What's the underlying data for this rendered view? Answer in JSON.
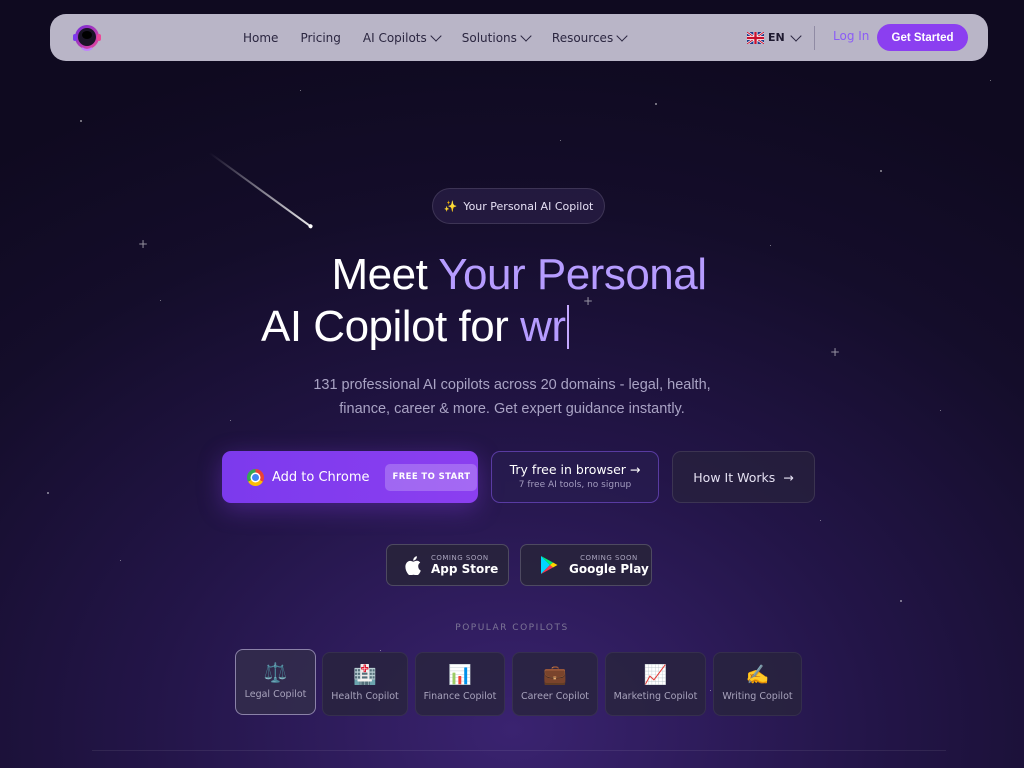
{
  "nav": {
    "links": [
      {
        "label": "Home"
      },
      {
        "label": "Pricing"
      },
      {
        "label": "AI Copilots"
      },
      {
        "label": "Solutions"
      },
      {
        "label": "Resources"
      }
    ],
    "language": "EN",
    "login": "Log In",
    "get_started": "Get Started"
  },
  "hero": {
    "badge_icon": "✨",
    "badge": "Your Personal AI Copilot",
    "title_part1": "Meet ",
    "title_highlight": "Your Personal",
    "title_part2": "AI Copilot for ",
    "typed_word": "wr",
    "subtitle_line1": "131 professional AI copilots across 20 domains - legal, health,",
    "subtitle_line2": "finance, career & more. Get expert guidance instantly."
  },
  "cta": {
    "chrome_label": "Add to Chrome",
    "chrome_tag": "FREE TO START",
    "browser_label": "Try free in browser →",
    "browser_sub": "7 free AI tools, no signup",
    "how_label": "How It Works",
    "how_arrow": "→"
  },
  "stores": {
    "app_small": "COMING SOON",
    "app_big": "App Store",
    "play_small": "COMING SOON",
    "play_big": "Google Play"
  },
  "popular": {
    "label": "POPULAR COPILOTS",
    "items": [
      {
        "icon": "⚖️",
        "label": "Legal Copilot"
      },
      {
        "icon": "🏥",
        "label": "Health Copilot"
      },
      {
        "icon": "📊",
        "label": "Finance Copilot"
      },
      {
        "icon": "💼",
        "label": "Career Copilot"
      },
      {
        "icon": "📈",
        "label": "Marketing Copilot"
      },
      {
        "icon": "✍️",
        "label": "Writing Copilot"
      }
    ]
  }
}
